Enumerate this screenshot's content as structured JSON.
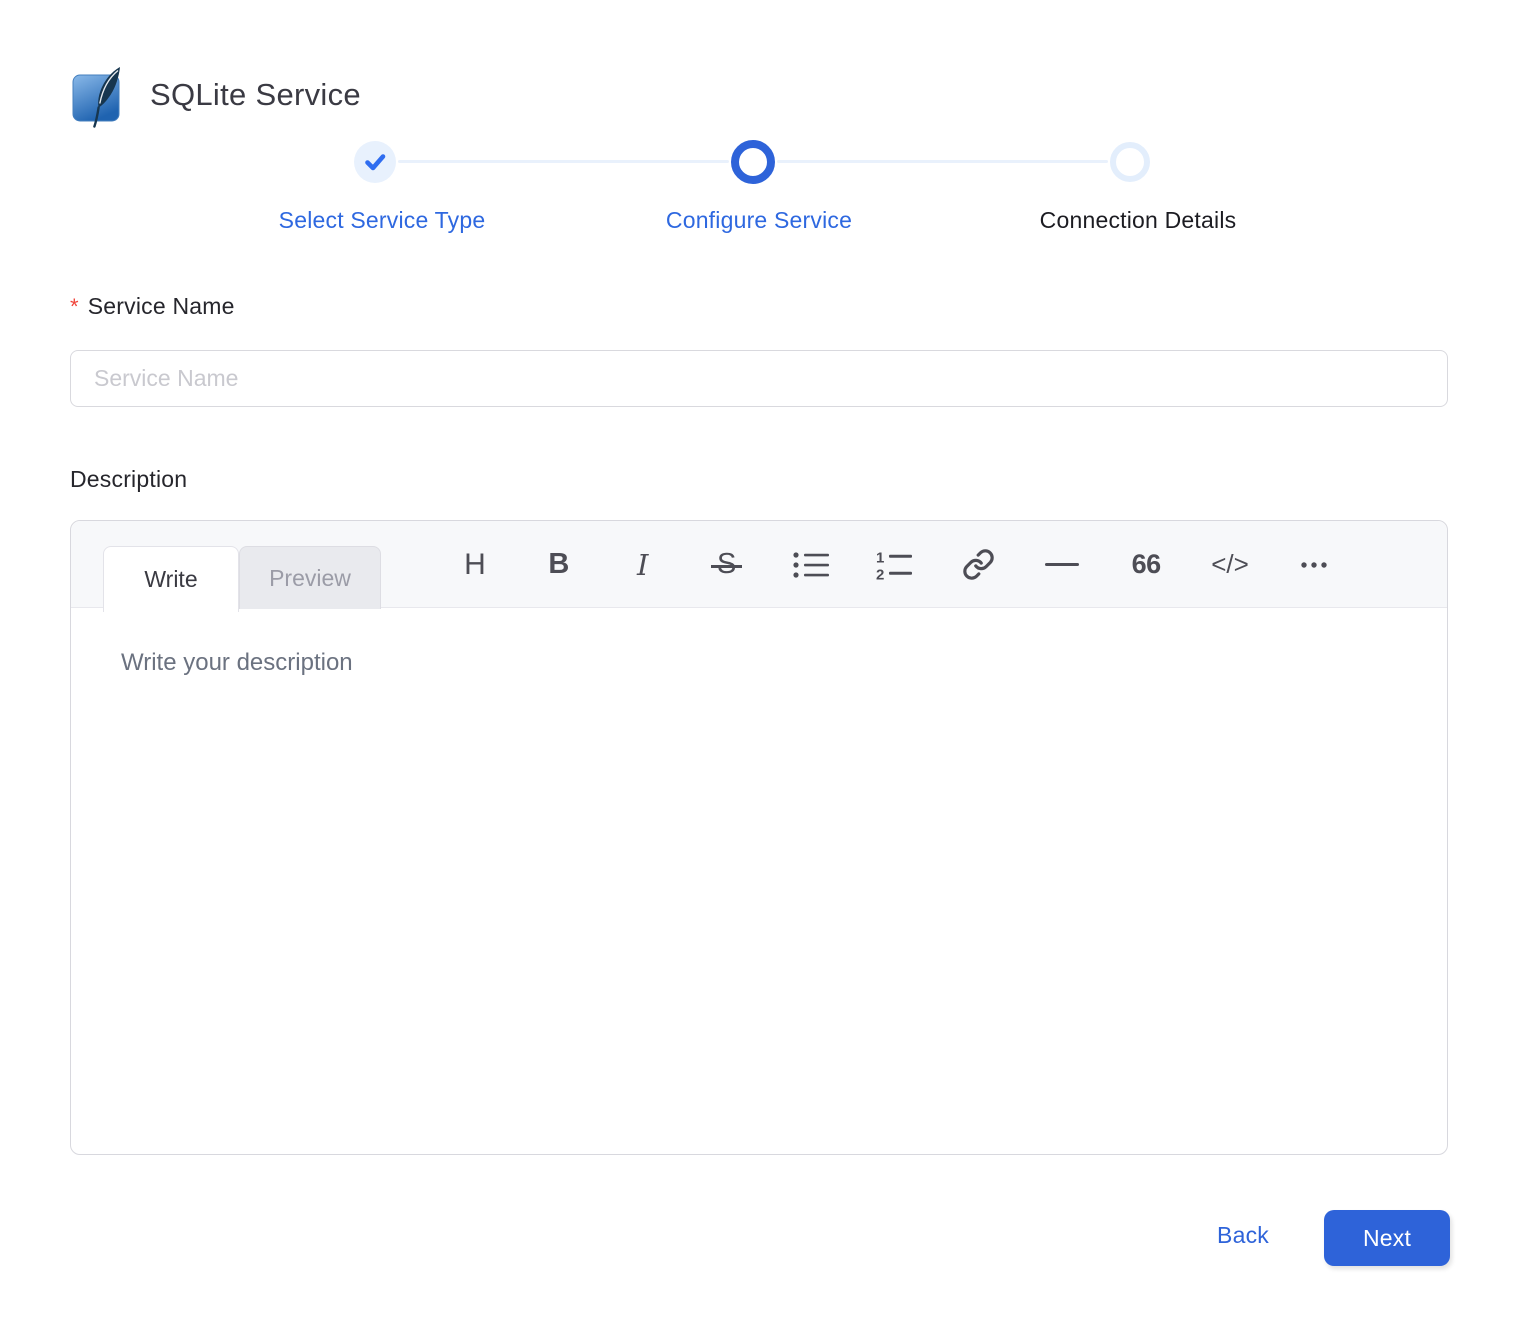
{
  "header": {
    "title": "SQLite Service",
    "logo_icon": "sqlite-feather-logo"
  },
  "stepper": {
    "steps": [
      {
        "label": "Select Service Type",
        "state": "completed",
        "icon": "check-icon"
      },
      {
        "label": "Configure Service",
        "state": "active"
      },
      {
        "label": "Connection Details",
        "state": "pending"
      }
    ]
  },
  "form": {
    "service_name": {
      "required_marker": "*",
      "label": "Service Name",
      "placeholder": "Service Name",
      "value": ""
    },
    "description": {
      "label": "Description"
    }
  },
  "editor": {
    "tabs": [
      {
        "label": "Write",
        "active": true
      },
      {
        "label": "Preview",
        "active": false
      }
    ],
    "toolbar": {
      "heading": "H",
      "bold": "B",
      "italic": "I",
      "strikethrough": "S",
      "ordered_list_digits": [
        "1",
        "2"
      ],
      "horizontal_rule": "",
      "quote": "66",
      "code": "</>",
      "icon_names": [
        "heading",
        "bold",
        "italic",
        "strikethrough",
        "unordered-list",
        "ordered-list",
        "link",
        "horizontal-rule",
        "quote",
        "code",
        "more"
      ]
    },
    "placeholder": "Write your description",
    "value": ""
  },
  "footer": {
    "back_label": "Back",
    "next_label": "Next"
  },
  "colors": {
    "primary_blue": "#2e63d9",
    "link_blue": "#2e68e0",
    "light_blue_fill": "#e8f1fd",
    "connector_blue": "#e9f1fc",
    "required_red": "#f0453c",
    "text_dark": "#27272e",
    "input_placeholder": "#c9c9cf",
    "editor_placeholder": "#6b7280",
    "icon_gray": "#4d4d55",
    "border_gray": "#d8d8de",
    "toolbar_strip_bg": "#f7f8fa",
    "preview_tab_bg": "#e9eaee"
  }
}
